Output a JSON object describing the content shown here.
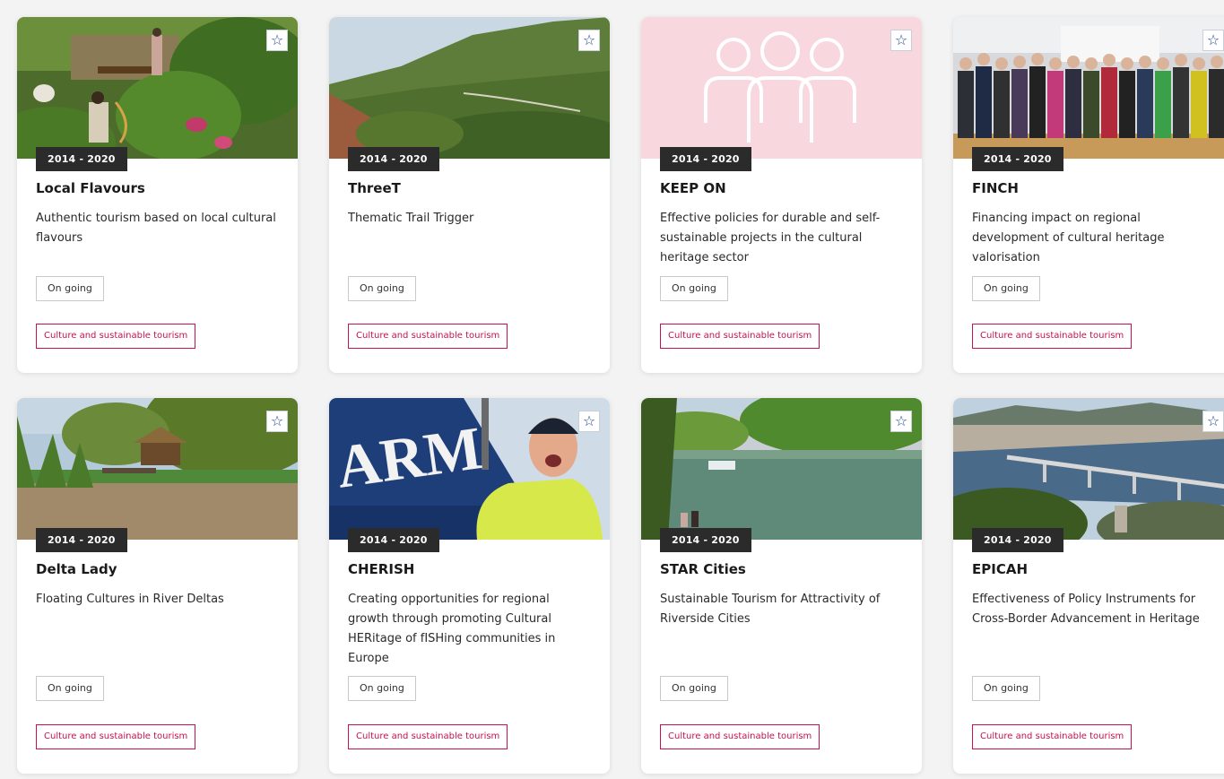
{
  "cards": [
    {
      "period": "2014 - 2020",
      "title": "Local Flavours",
      "description": "Authentic tourism based on local cultural flavours",
      "status": "On going",
      "theme": "Culture and sustainable tourism",
      "favorite_icon": "star-outline-icon"
    },
    {
      "period": "2014 - 2020",
      "title": "ThreeT",
      "description": "Thematic Trail Trigger",
      "status": "On going",
      "theme": "Culture and sustainable tourism",
      "favorite_icon": "star-outline-icon"
    },
    {
      "period": "2014 - 2020",
      "title": "KEEP ON",
      "description": "Effective policies for durable and self-sustainable projects in the cultural heritage sector",
      "status": "On going",
      "theme": "Culture and sustainable tourism",
      "favorite_icon": "star-outline-icon"
    },
    {
      "period": "2014 - 2020",
      "title": "FINCH",
      "description": "Financing impact on regional development of cultural heritage valorisation",
      "status": "On going",
      "theme": "Culture and sustainable tourism",
      "favorite_icon": "star-outline-icon"
    },
    {
      "period": "2014 - 2020",
      "title": "Delta Lady",
      "description": "Floating Cultures in River Deltas",
      "status": "On going",
      "theme": "Culture and sustainable tourism",
      "favorite_icon": "star-outline-icon"
    },
    {
      "period": "2014 - 2020",
      "title": "CHERISH",
      "description": "Creating opportunities for regional growth through promoting Cultural HERitage of fISHing communities in Europe",
      "status": "On going",
      "theme": "Culture and sustainable tourism",
      "favorite_icon": "star-outline-icon"
    },
    {
      "period": "2014 - 2020",
      "title": "STAR Cities",
      "description": "Sustainable Tourism for Attractivity of Riverside Cities",
      "status": "On going",
      "theme": "Culture and sustainable tourism",
      "favorite_icon": "star-outline-icon"
    },
    {
      "period": "2014 - 2020",
      "title": "EPICAH",
      "description": "Effectiveness of Policy Instruments for Cross-Border Advancement in Heritage",
      "status": "On going",
      "theme": "Culture and sustainable tourism",
      "favorite_icon": "star-outline-icon"
    }
  ],
  "images": {
    "card_5_boat_text": "ARM"
  },
  "colors": {
    "theme_accent": "#c4124b",
    "favorite_icon": "#1c3f8c",
    "period_badge": "#2b2b2b",
    "keep_on_placeholder": "#f8d7de"
  }
}
